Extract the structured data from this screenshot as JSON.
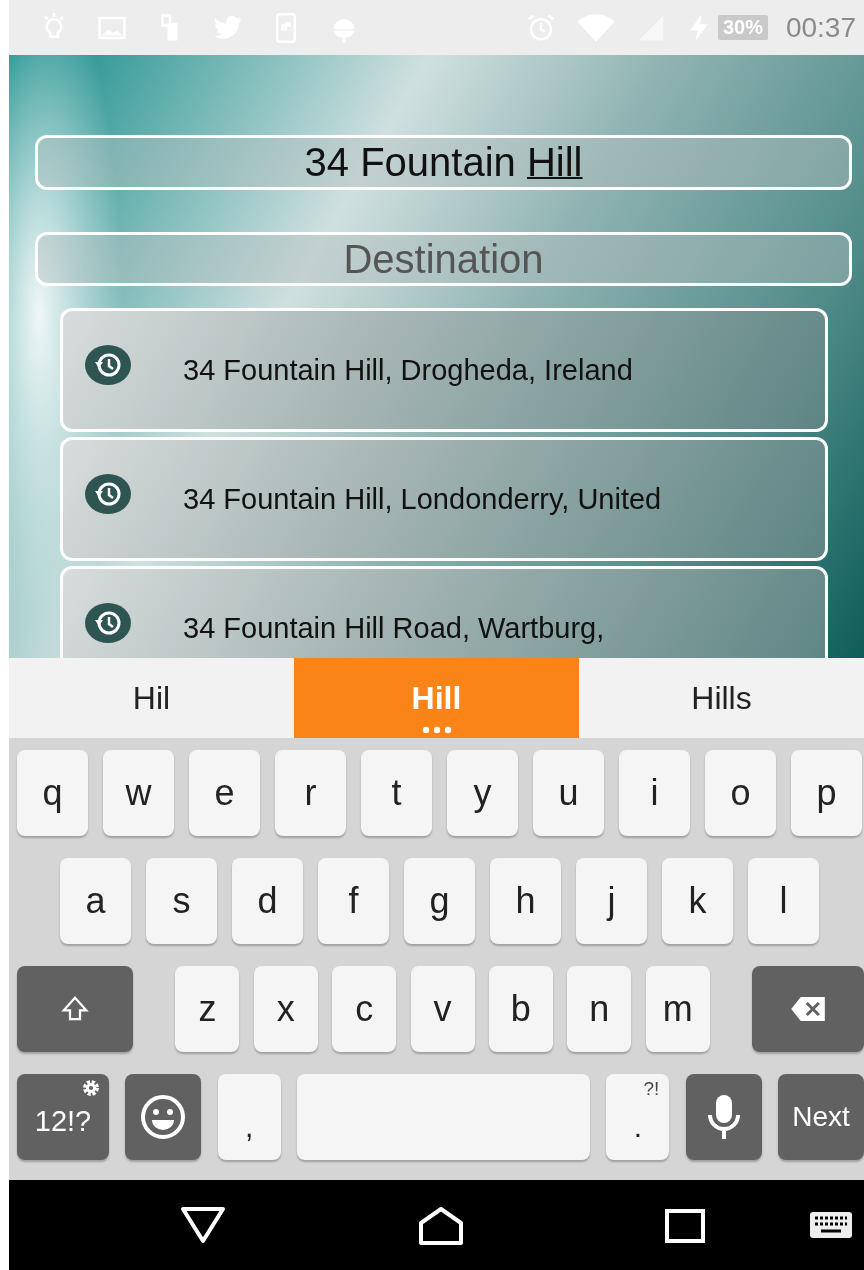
{
  "status_bar": {
    "battery": "30%",
    "time": "00:37"
  },
  "origin": {
    "typed": "34 Fountain",
    "composing": "Hill"
  },
  "destination": {
    "placeholder": "Destination"
  },
  "results": [
    {
      "text": "34 Fountain Hill, Drogheda, Ireland"
    },
    {
      "text": "34 Fountain Hill, Londonderry, United"
    },
    {
      "text": "34 Fountain Hill Road, Wartburg,"
    }
  ],
  "suggestions": [
    {
      "text": "Hil",
      "selected": false
    },
    {
      "text": "Hill",
      "selected": true
    },
    {
      "text": "Hills",
      "selected": false
    }
  ],
  "keyboard": {
    "rows": [
      {
        "keys": [
          {
            "kind": "letter",
            "label": "q"
          },
          {
            "kind": "letter",
            "label": "w"
          },
          {
            "kind": "letter",
            "label": "e"
          },
          {
            "kind": "letter",
            "label": "r"
          },
          {
            "kind": "letter",
            "label": "t"
          },
          {
            "kind": "letter",
            "label": "y"
          },
          {
            "kind": "letter",
            "label": "u"
          },
          {
            "kind": "letter",
            "label": "i"
          },
          {
            "kind": "letter",
            "label": "o"
          },
          {
            "kind": "letter",
            "label": "p"
          }
        ]
      },
      {
        "keys": [
          {
            "kind": "letter",
            "label": "a"
          },
          {
            "kind": "letter",
            "label": "s"
          },
          {
            "kind": "letter",
            "label": "d"
          },
          {
            "kind": "letter",
            "label": "f"
          },
          {
            "kind": "letter",
            "label": "g"
          },
          {
            "kind": "letter",
            "label": "h"
          },
          {
            "kind": "letter",
            "label": "j"
          },
          {
            "kind": "letter",
            "label": "k"
          },
          {
            "kind": "letter",
            "label": "l"
          }
        ]
      },
      {
        "keys": [
          {
            "kind": "shift"
          },
          {
            "kind": "letter",
            "label": "z"
          },
          {
            "kind": "letter",
            "label": "x"
          },
          {
            "kind": "letter",
            "label": "c"
          },
          {
            "kind": "letter",
            "label": "v"
          },
          {
            "kind": "letter",
            "label": "b"
          },
          {
            "kind": "letter",
            "label": "n"
          },
          {
            "kind": "letter",
            "label": "m"
          },
          {
            "kind": "backspace"
          }
        ]
      },
      {
        "keys": [
          {
            "kind": "symbols",
            "label": "12!?"
          },
          {
            "kind": "emoji"
          },
          {
            "kind": "punct",
            "label": ","
          },
          {
            "kind": "space"
          },
          {
            "kind": "punct",
            "label": ".",
            "hint": "?!"
          },
          {
            "kind": "mic"
          },
          {
            "kind": "action",
            "label": "Next"
          }
        ]
      }
    ]
  }
}
